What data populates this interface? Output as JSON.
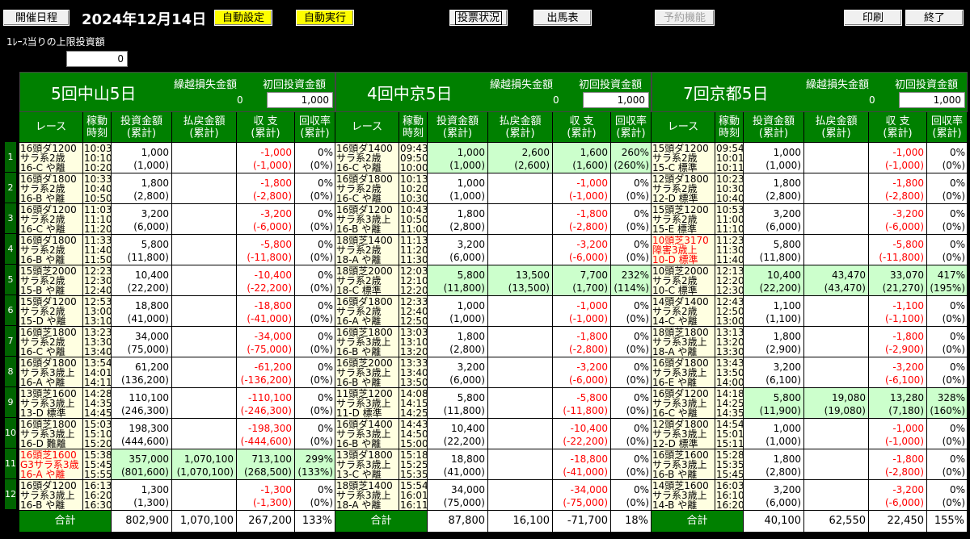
{
  "toolbar": {
    "schedule": "開催日程",
    "date": "2024年12月14日",
    "auto_setting": "自動設定",
    "auto_run": "自動実行",
    "vote_status": "投票状況",
    "entry_table": "出馬表",
    "reservation": "予約機能",
    "print": "印刷",
    "exit": "終了"
  },
  "limit": {
    "label": "1ﾚｰｽ当りの上限投資額",
    "value": "0"
  },
  "rows": [
    "1",
    "2",
    "3",
    "4",
    "5",
    "6",
    "7",
    "8",
    "9",
    "10",
    "11",
    "12"
  ],
  "headers": {
    "race": "レース",
    "time": "稼動\n時刻",
    "invest": "投資金額\n(累計)",
    "payout": "払戻金額\n(累計)",
    "balance": "収 支\n(累計)",
    "rate": "回収率\n(累計)",
    "carry_loss": "繰越損失金額",
    "initial": "初回投資金額",
    "total": "合計"
  },
  "venues": [
    {
      "name": "5回中山5日",
      "carry_loss": "0",
      "initial": "1,000",
      "total": {
        "invest": "802,900",
        "payout": "1,070,100",
        "balance": "267,200",
        "rate": "133%"
      },
      "races": [
        {
          "r1": "16頭ダ1200",
          "r2": "サラ系2歳",
          "r3": "16-C  や離",
          "t1": "10:03",
          "t2": "10:10",
          "t3": "10:20",
          "inv": "1,000",
          "invc": "(1,000)",
          "pay": "",
          "payc": "",
          "bal": "-1,000",
          "balc": "(-1,000)",
          "rr": "0%",
          "rrc": "(0%)",
          "hit": false,
          "red": false
        },
        {
          "r1": "16頭ダ1800",
          "r2": "サラ系2歳",
          "r3": "16-B  や離",
          "t1": "10:33",
          "t2": "10:40",
          "t3": "10:50",
          "inv": "1,800",
          "invc": "(2,800)",
          "pay": "",
          "payc": "",
          "bal": "-1,800",
          "balc": "(-2,800)",
          "rr": "0%",
          "rrc": "(0%)",
          "hit": false,
          "red": false
        },
        {
          "r1": "16頭ダ1200",
          "r2": "サラ系2歳",
          "r3": "16-C  や離",
          "t1": "11:03",
          "t2": "11:10",
          "t3": "11:20",
          "inv": "3,200",
          "invc": "(6,000)",
          "pay": "",
          "payc": "",
          "bal": "-3,200",
          "balc": "(-6,000)",
          "rr": "0%",
          "rrc": "(0%)",
          "hit": false,
          "red": false
        },
        {
          "r1": "16頭ダ1800",
          "r2": "サラ系2歳",
          "r3": "16-B  や離",
          "t1": "11:33",
          "t2": "11:40",
          "t3": "11:50",
          "inv": "5,800",
          "invc": "(11,800)",
          "pay": "",
          "payc": "",
          "bal": "-5,800",
          "balc": "(-11,800)",
          "rr": "0%",
          "rrc": "(0%)",
          "hit": false,
          "red": false
        },
        {
          "r1": "15頭芝2000",
          "r2": "サラ系2歳",
          "r3": "15-B  や離",
          "t1": "12:23",
          "t2": "12:30",
          "t3": "12:40",
          "inv": "10,400",
          "invc": "(22,200)",
          "pay": "",
          "payc": "",
          "bal": "-10,400",
          "balc": "(-22,200)",
          "rr": "0%",
          "rrc": "(0%)",
          "hit": false,
          "red": false
        },
        {
          "r1": "15頭ダ1200",
          "r2": "サラ系2歳",
          "r3": "15-D  や離",
          "t1": "12:53",
          "t2": "13:00",
          "t3": "13:10",
          "inv": "18,800",
          "invc": "(41,000)",
          "pay": "",
          "payc": "",
          "bal": "-18,800",
          "balc": "(-41,000)",
          "rr": "0%",
          "rrc": "(0%)",
          "hit": false,
          "red": false
        },
        {
          "r1": "16頭芝1800",
          "r2": "サラ系2歳",
          "r3": "16-C  や離",
          "t1": "13:23",
          "t2": "13:30",
          "t3": "13:40",
          "inv": "34,000",
          "invc": "(75,000)",
          "pay": "",
          "payc": "",
          "bal": "-34,000",
          "balc": "(-75,000)",
          "rr": "0%",
          "rrc": "(0%)",
          "hit": false,
          "red": false
        },
        {
          "r1": "16頭ダ1800",
          "r2": "サラ系3歳上",
          "r3": "16-A  や離",
          "t1": "13:54",
          "t2": "14:01",
          "t3": "14:11",
          "inv": "61,200",
          "invc": "(136,200)",
          "pay": "",
          "payc": "",
          "bal": "-61,200",
          "balc": "(-136,200)",
          "rr": "0%",
          "rrc": "(0%)",
          "hit": false,
          "red": false
        },
        {
          "r1": "13頭芝1600",
          "r2": "サラ系3歳上",
          "r3": "13-D  標準",
          "t1": "14:28",
          "t2": "14:35",
          "t3": "14:45",
          "inv": "110,100",
          "invc": "(246,300)",
          "pay": "",
          "payc": "",
          "bal": "-110,100",
          "balc": "(-246,300)",
          "rr": "0%",
          "rrc": "(0%)",
          "hit": false,
          "red": false
        },
        {
          "r1": "16頭芝1800",
          "r2": "サラ系3歳上",
          "r3": "16-D  難離",
          "t1": "15:03",
          "t2": "15:10",
          "t3": "15:20",
          "inv": "198,300",
          "invc": "(444,600)",
          "pay": "",
          "payc": "",
          "bal": "-198,300",
          "balc": "(-444,600)",
          "rr": "0%",
          "rrc": "(0%)",
          "hit": false,
          "red": false
        },
        {
          "r1": "16頭芝1600",
          "r2": "G3サラ系3歳",
          "r3": "16-A  や離",
          "t1": "15:38",
          "t2": "15:45",
          "t3": "15:55",
          "inv": "357,000",
          "invc": "(801,600)",
          "pay": "1,070,100",
          "payc": "(1,070,100)",
          "bal": "713,100",
          "balc": "(268,500)",
          "rr": "299%",
          "rrc": "(133%)",
          "hit": true,
          "red": true
        },
        {
          "r1": "16頭ダ1200",
          "r2": "サラ系3歳上",
          "r3": "16-B  や離",
          "t1": "16:13",
          "t2": "16:20",
          "t3": "16:30",
          "inv": "1,300",
          "invc": "(1,300)",
          "pay": "",
          "payc": "",
          "bal": "-1,300",
          "balc": "(-1,300)",
          "rr": "0%",
          "rrc": "(0%)",
          "hit": false,
          "red": false
        }
      ]
    },
    {
      "name": "4回中京5日",
      "carry_loss": "0",
      "initial": "1,000",
      "total": {
        "invest": "87,800",
        "payout": "16,100",
        "balance": "-71,700",
        "rate": "18%"
      },
      "races": [
        {
          "r1": "16頭ダ1400",
          "r2": "サラ系2歳",
          "r3": "16-C  や離",
          "t1": "09:43",
          "t2": "09:50",
          "t3": "10:00",
          "inv": "1,000",
          "invc": "(1,000)",
          "pay": "2,600",
          "payc": "(2,600)",
          "bal": "1,600",
          "balc": "(1,600)",
          "rr": "260%",
          "rrc": "(260%)",
          "hit": true,
          "red": false
        },
        {
          "r1": "16頭ダ1800",
          "r2": "サラ系2歳",
          "r3": "16-C  や離",
          "t1": "10:13",
          "t2": "10:20",
          "t3": "10:30",
          "inv": "1,000",
          "invc": "(1,000)",
          "pay": "",
          "payc": "",
          "bal": "-1,000",
          "balc": "(-1,000)",
          "rr": "0%",
          "rrc": "(0%)",
          "hit": false,
          "red": false
        },
        {
          "r1": "16頭ダ1200",
          "r2": "サラ系3歳上",
          "r3": "16-B  や離",
          "t1": "10:43",
          "t2": "10:50",
          "t3": "11:00",
          "inv": "1,800",
          "invc": "(2,800)",
          "pay": "",
          "payc": "",
          "bal": "-1,800",
          "balc": "(-2,800)",
          "rr": "0%",
          "rrc": "(0%)",
          "hit": false,
          "red": false
        },
        {
          "r1": "18頭芝1400",
          "r2": "サラ系2歳",
          "r3": "18-A  や離",
          "t1": "11:13",
          "t2": "11:20",
          "t3": "11:30",
          "inv": "3,200",
          "invc": "(6,000)",
          "pay": "",
          "payc": "",
          "bal": "-3,200",
          "balc": "(-6,000)",
          "rr": "0%",
          "rrc": "(0%)",
          "hit": false,
          "red": false
        },
        {
          "r1": "18頭芝2000",
          "r2": "サラ系2歳",
          "r3": "18-C  標準",
          "t1": "12:03",
          "t2": "12:10",
          "t3": "12:20",
          "inv": "5,800",
          "invc": "(11,800)",
          "pay": "13,500",
          "payc": "(13,500)",
          "bal": "7,700",
          "balc": "(1,700)",
          "rr": "232%",
          "rrc": "(114%)",
          "hit": true,
          "red": false
        },
        {
          "r1": "16頭ダ1800",
          "r2": "サラ系2歳",
          "r3": "16-A  や離",
          "t1": "12:33",
          "t2": "12:40",
          "t3": "12:50",
          "inv": "1,000",
          "invc": "(1,000)",
          "pay": "",
          "payc": "",
          "bal": "-1,000",
          "balc": "(-1,000)",
          "rr": "0%",
          "rrc": "(0%)",
          "hit": false,
          "red": false
        },
        {
          "r1": "16頭芝1800",
          "r2": "サラ系3歳上",
          "r3": "16-B  や離",
          "t1": "13:03",
          "t2": "13:10",
          "t3": "13:20",
          "inv": "1,800",
          "invc": "(2,800)",
          "pay": "",
          "payc": "",
          "bal": "-1,800",
          "balc": "(-2,800)",
          "rr": "0%",
          "rrc": "(0%)",
          "hit": false,
          "red": false
        },
        {
          "r1": "16頭芝2000",
          "r2": "サラ系3歳上",
          "r3": "16-B  や離",
          "t1": "13:33",
          "t2": "13:40",
          "t3": "13:50",
          "inv": "3,200",
          "invc": "(6,000)",
          "pay": "",
          "payc": "",
          "bal": "-3,200",
          "balc": "(-6,000)",
          "rr": "0%",
          "rrc": "(0%)",
          "hit": false,
          "red": false
        },
        {
          "r1": "11頭芝1200",
          "r2": "サラ系3歳上",
          "r3": "11-D  標準",
          "t1": "14:08",
          "t2": "14:15",
          "t3": "14:25",
          "inv": "5,800",
          "invc": "(11,800)",
          "pay": "",
          "payc": "",
          "bal": "-5,800",
          "balc": "(-11,800)",
          "rr": "0%",
          "rrc": "(0%)",
          "hit": false,
          "red": false
        },
        {
          "r1": "16頭ダ1400",
          "r2": "サラ系3歳上",
          "r3": "16-B  や離",
          "t1": "14:43",
          "t2": "14:50",
          "t3": "15:00",
          "inv": "10,400",
          "invc": "(22,200)",
          "pay": "",
          "payc": "",
          "bal": "-10,400",
          "balc": "(-22,200)",
          "rr": "0%",
          "rrc": "(0%)",
          "hit": false,
          "red": false
        },
        {
          "r1": "13頭ダ1800",
          "r2": "サラ系3歳上",
          "r3": "13-C  や離",
          "t1": "15:18",
          "t2": "15:25",
          "t3": "15:35",
          "inv": "18,800",
          "invc": "(41,000)",
          "pay": "",
          "payc": "",
          "bal": "-18,800",
          "balc": "(-41,000)",
          "rr": "0%",
          "rrc": "(0%)",
          "hit": false,
          "red": false
        },
        {
          "r1": "18頭芝1400",
          "r2": "サラ系3歳上",
          "r3": "18-A  や離",
          "t1": "15:54",
          "t2": "16:01",
          "t3": "16:11",
          "inv": "34,000",
          "invc": "(75,000)",
          "pay": "",
          "payc": "",
          "bal": "-34,000",
          "balc": "(-75,000)",
          "rr": "0%",
          "rrc": "(0%)",
          "hit": false,
          "red": false
        }
      ]
    },
    {
      "name": "7回京都5日",
      "carry_loss": "0",
      "initial": "1,000",
      "total": {
        "invest": "40,100",
        "payout": "62,550",
        "balance": "22,450",
        "rate": "155%"
      },
      "races": [
        {
          "r1": "15頭ダ1200",
          "r2": "サラ系2歳",
          "r3": "15-C  標準",
          "t1": "09:54",
          "t2": "10:01",
          "t3": "10:11",
          "inv": "1,000",
          "invc": "(1,000)",
          "pay": "",
          "payc": "",
          "bal": "-1,000",
          "balc": "(-1,000)",
          "rr": "0%",
          "rrc": "(0%)",
          "hit": false,
          "red": false
        },
        {
          "r1": "12頭ダ1800",
          "r2": "サラ系2歳",
          "r3": "12-D  標準",
          "t1": "10:23",
          "t2": "10:30",
          "t3": "10:40",
          "inv": "1,800",
          "invc": "(2,800)",
          "pay": "",
          "payc": "",
          "bal": "-1,800",
          "balc": "(-2,800)",
          "rr": "0%",
          "rrc": "(0%)",
          "hit": false,
          "red": false
        },
        {
          "r1": "15頭芝1200",
          "r2": "サラ系2歳",
          "r3": "15-E  標準",
          "t1": "10:53",
          "t2": "11:00",
          "t3": "11:10",
          "inv": "3,200",
          "invc": "(6,000)",
          "pay": "",
          "payc": "",
          "bal": "-3,200",
          "balc": "(-6,000)",
          "rr": "0%",
          "rrc": "(0%)",
          "hit": false,
          "red": false
        },
        {
          "r1": "10頭芝3170",
          "r2": "障害3歳上",
          "r3": "10-D  標準",
          "t1": "11:23",
          "t2": "11:30",
          "t3": "11:40",
          "inv": "5,800",
          "invc": "(11,800)",
          "pay": "",
          "payc": "",
          "bal": "-5,800",
          "balc": "(-11,800)",
          "rr": "0%",
          "rrc": "(0%)",
          "hit": false,
          "red": true
        },
        {
          "r1": "10頭芝2000",
          "r2": "サラ系2歳",
          "r3": "10-C  標準",
          "t1": "12:13",
          "t2": "12:20",
          "t3": "12:30",
          "inv": "10,400",
          "invc": "(22,200)",
          "pay": "43,470",
          "payc": "(43,470)",
          "bal": "33,070",
          "balc": "(21,270)",
          "rr": "417%",
          "rrc": "(195%)",
          "hit": true,
          "red": false
        },
        {
          "r1": "14頭ダ1400",
          "r2": "サラ系2歳",
          "r3": "14-C  や離",
          "t1": "12:43",
          "t2": "12:50",
          "t3": "13:00",
          "inv": "1,100",
          "invc": "(1,100)",
          "pay": "",
          "payc": "",
          "bal": "-1,100",
          "balc": "(-1,100)",
          "rr": "0%",
          "rrc": "(0%)",
          "hit": false,
          "red": false
        },
        {
          "r1": "18頭芝1800",
          "r2": "サラ系3歳上",
          "r3": "18-A  や離",
          "t1": "13:13",
          "t2": "13:20",
          "t3": "13:30",
          "inv": "1,800",
          "invc": "(2,900)",
          "pay": "",
          "payc": "",
          "bal": "-1,800",
          "balc": "(-2,900)",
          "rr": "0%",
          "rrc": "(0%)",
          "hit": false,
          "red": false
        },
        {
          "r1": "16頭ダ1800",
          "r2": "サラ系3歳上",
          "r3": "16-E  や離",
          "t1": "13:43",
          "t2": "13:50",
          "t3": "14:00",
          "inv": "3,200",
          "invc": "(6,100)",
          "pay": "",
          "payc": "",
          "bal": "-3,200",
          "balc": "(-6,100)",
          "rr": "0%",
          "rrc": "(0%)",
          "hit": false,
          "red": false
        },
        {
          "r1": "16頭ダ1200",
          "r2": "サラ系3歳上",
          "r3": "16-C  や離",
          "t1": "14:18",
          "t2": "14:25",
          "t3": "14:35",
          "inv": "5,800",
          "invc": "(11,900)",
          "pay": "19,080",
          "payc": "(19,080)",
          "bal": "13,280",
          "balc": "(7,180)",
          "rr": "328%",
          "rrc": "(160%)",
          "hit": true,
          "red": false
        },
        {
          "r1": "12頭ダ1800",
          "r2": "サラ系3歳上",
          "r3": "12-D  標準",
          "t1": "14:54",
          "t2": "15:01",
          "t3": "15:11",
          "inv": "1,000",
          "invc": "(1,000)",
          "pay": "",
          "payc": "",
          "bal": "-1,000",
          "balc": "(-1,000)",
          "rr": "0%",
          "rrc": "(0%)",
          "hit": false,
          "red": false
        },
        {
          "r1": "16頭芝1600",
          "r2": "サラ系3歳上",
          "r3": "16-B  や離",
          "t1": "15:28",
          "t2": "15:35",
          "t3": "15:45",
          "inv": "1,800",
          "invc": "(2,800)",
          "pay": "",
          "payc": "",
          "bal": "-1,800",
          "balc": "(-2,800)",
          "rr": "0%",
          "rrc": "(0%)",
          "hit": false,
          "red": false
        },
        {
          "r1": "14頭芝1600",
          "r2": "サラ系3歳上",
          "r3": "14-B  や離",
          "t1": "16:03",
          "t2": "16:10",
          "t3": "16:20",
          "inv": "3,200",
          "invc": "(6,000)",
          "pay": "",
          "payc": "",
          "bal": "-3,200",
          "balc": "(-6,000)",
          "rr": "0%",
          "rrc": "(0%)",
          "hit": false,
          "red": false
        }
      ]
    }
  ]
}
